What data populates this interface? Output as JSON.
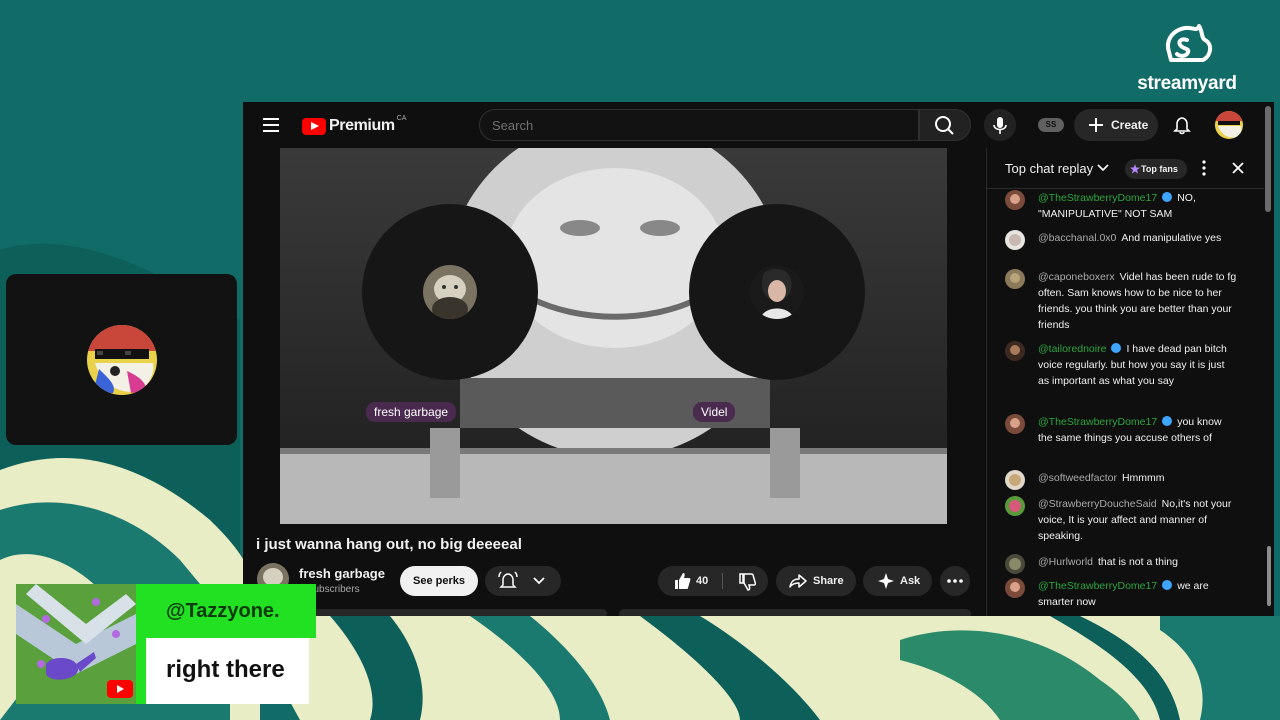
{
  "brand": {
    "name": "streamyard"
  },
  "youtube": {
    "logo": "Premium",
    "region": "CA",
    "search_placeholder": "Search",
    "account_badge": "SS",
    "create_label": "Create",
    "participants": [
      {
        "name": "fresh garbage"
      },
      {
        "name": "Videl"
      }
    ],
    "video_title": "i just wanna hang out, no big deeeeal",
    "channel": {
      "name": "fresh garbage",
      "subscribers": "K subscribers"
    },
    "see_perks": "See perks",
    "likes": "40",
    "share": "Share",
    "ask": "Ask"
  },
  "chat": {
    "title": "Top chat replay",
    "top_fans": "Top fans",
    "messages": [
      {
        "author": "@TheStrawberryDome17",
        "text": "NO, \"MANIPULATIVE\" NOT SAM"
      },
      {
        "author": "@bacchanal.0x0",
        "text": "And manipulative yes"
      },
      {
        "author": "@caponeboxerx",
        "text": "Videl has been rude to fg often. Sam knows how to be nice to her friends. you think you are better than your friends"
      },
      {
        "author": "@tailorednoire",
        "text": "I have dead pan bitch voice regularly. but how you say it is just as important as what you say"
      },
      {
        "author": "@TheStrawberryDome17",
        "text": "you know the same things you accuse others of"
      },
      {
        "author": "@softweedfactor",
        "text": "Hmmmm"
      },
      {
        "author": "@StrawberryDoucheSaid",
        "text": "No,it's not your voice, It is your affect and manner of speaking."
      },
      {
        "author": "@Hurlworld",
        "text": "that is not a thing"
      },
      {
        "author": "@TheStrawberryDome17",
        "text": "we are smarter now"
      }
    ]
  },
  "banner": {
    "name": "@Tazzyone.",
    "message": "right there"
  },
  "colors": {
    "background": "#116b66",
    "banner_green": "#22e022",
    "youtube_red": "#ff0000",
    "verified_blue": "#3ea6ff"
  }
}
